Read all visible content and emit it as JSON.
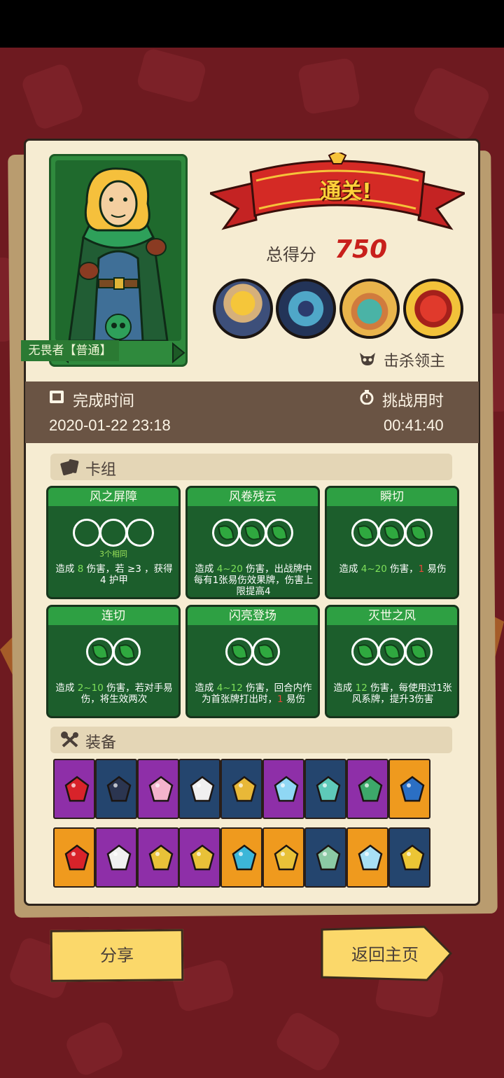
{
  "result_banner": "通关!",
  "score": {
    "label": "总得分",
    "value": "750"
  },
  "hero": {
    "name": "无畏者【普通】"
  },
  "bosses": [
    "boss-straw-hat-monk",
    "boss-crowned-squid",
    "boss-serpent-head",
    "boss-red-demon"
  ],
  "kill_label": "击杀领主",
  "completion": {
    "label": "完成时间",
    "value": "2020-01-22 23:18"
  },
  "challenge": {
    "label": "挑战用时",
    "value": "00:41:40"
  },
  "deck": {
    "title": "卡组",
    "cards": [
      {
        "title": "风之屏障",
        "orbs": 3,
        "filled": false,
        "sub": "3个相同",
        "desc_parts": [
          "造成 ",
          "8",
          " 伤害，若 ",
          "≥3 ，获得 ",
          "4",
          " 护甲"
        ]
      },
      {
        "title": "风卷残云",
        "orbs": 3,
        "filled": true,
        "sub": "",
        "desc_parts": [
          "造成 ",
          "4~20",
          " 伤害，出战牌中每有1张易伤效果牌，伤害上限提高4"
        ]
      },
      {
        "title": "瞬切",
        "orbs": 3,
        "filled": true,
        "sub": "",
        "desc_parts": [
          "造成 ",
          "4~20",
          " 伤害，",
          "1",
          " 易伤"
        ]
      },
      {
        "title": "连切",
        "orbs": 2,
        "filled": true,
        "sub": "",
        "desc_parts": [
          "造成 ",
          "2~10",
          " 伤害，若对手",
          "易伤，将生效两次"
        ]
      },
      {
        "title": "闪亮登场",
        "orbs": 2,
        "filled": true,
        "sub": "",
        "desc_parts": [
          "造成 ",
          "4~12",
          " 伤害，回合内作为首张牌打出时，",
          "1",
          " 易伤"
        ]
      },
      {
        "title": "灭世之风",
        "orbs": 3,
        "filled": true,
        "sub": "",
        "desc_parts": [
          "造成 ",
          "12",
          " 伤害，每使用过1张",
          "风系牌，提升3伤害"
        ]
      }
    ]
  },
  "equipment": {
    "title": "装备",
    "row1": [
      {
        "icon": "ruby-gem-icon",
        "bg": "#8e2fa8",
        "c": "#d8232a"
      },
      {
        "icon": "top-hat-icon",
        "bg": "#24456e",
        "c": "#2b3550"
      },
      {
        "icon": "pink-crystal-icon",
        "bg": "#8e2fa8",
        "c": "#f3b3cc"
      },
      {
        "icon": "skull-dagger-icon",
        "bg": "#24456e",
        "c": "#f0f0f0"
      },
      {
        "icon": "golden-helmet-icon",
        "bg": "#24456e",
        "c": "#e8b838"
      },
      {
        "icon": "blue-diamond-icon",
        "bg": "#8e2fa8",
        "c": "#8fd7f4"
      },
      {
        "icon": "treasure-box-icon",
        "bg": "#24456e",
        "c": "#5ec9b9"
      },
      {
        "icon": "tribal-totem-icon",
        "bg": "#8e2fa8",
        "c": "#3da86a"
      },
      {
        "icon": "spiked-mace-icon",
        "bg": "#ef9a1e",
        "c": "#2b6fc4"
      }
    ],
    "row2": [
      {
        "icon": "demon-mask-icon",
        "bg": "#ef9a1e",
        "c": "#d8232a"
      },
      {
        "icon": "cursed-scroll-icon",
        "bg": "#8e2fa8",
        "c": "#f0f0f0"
      },
      {
        "icon": "gold-ring-icon",
        "bg": "#8e2fa8",
        "c": "#e8c138"
      },
      {
        "icon": "cross-ring-icon",
        "bg": "#8e2fa8",
        "c": "#e8c138"
      },
      {
        "icon": "sapphire-amulet-icon",
        "bg": "#ef9a1e",
        "c": "#3cb6d8"
      },
      {
        "icon": "knight-helm-icon",
        "bg": "#ef9a1e",
        "c": "#e8c138"
      },
      {
        "icon": "emerald-bracelet-icon",
        "bg": "#24456e",
        "c": "#8bc9a4"
      },
      {
        "icon": "crystal-shard-icon",
        "bg": "#ef9a1e",
        "c": "#a8e0f4"
      },
      {
        "icon": "golden-key-icon",
        "bg": "#24456e",
        "c": "#ecc535"
      }
    ]
  },
  "buttons": {
    "share": "分享",
    "home": "返回主页"
  },
  "colors": {
    "paper": "#f6ecd2",
    "card_green": "#1c5e2c",
    "accent_red": "#c8201c",
    "button_yellow": "#fbd86a"
  }
}
